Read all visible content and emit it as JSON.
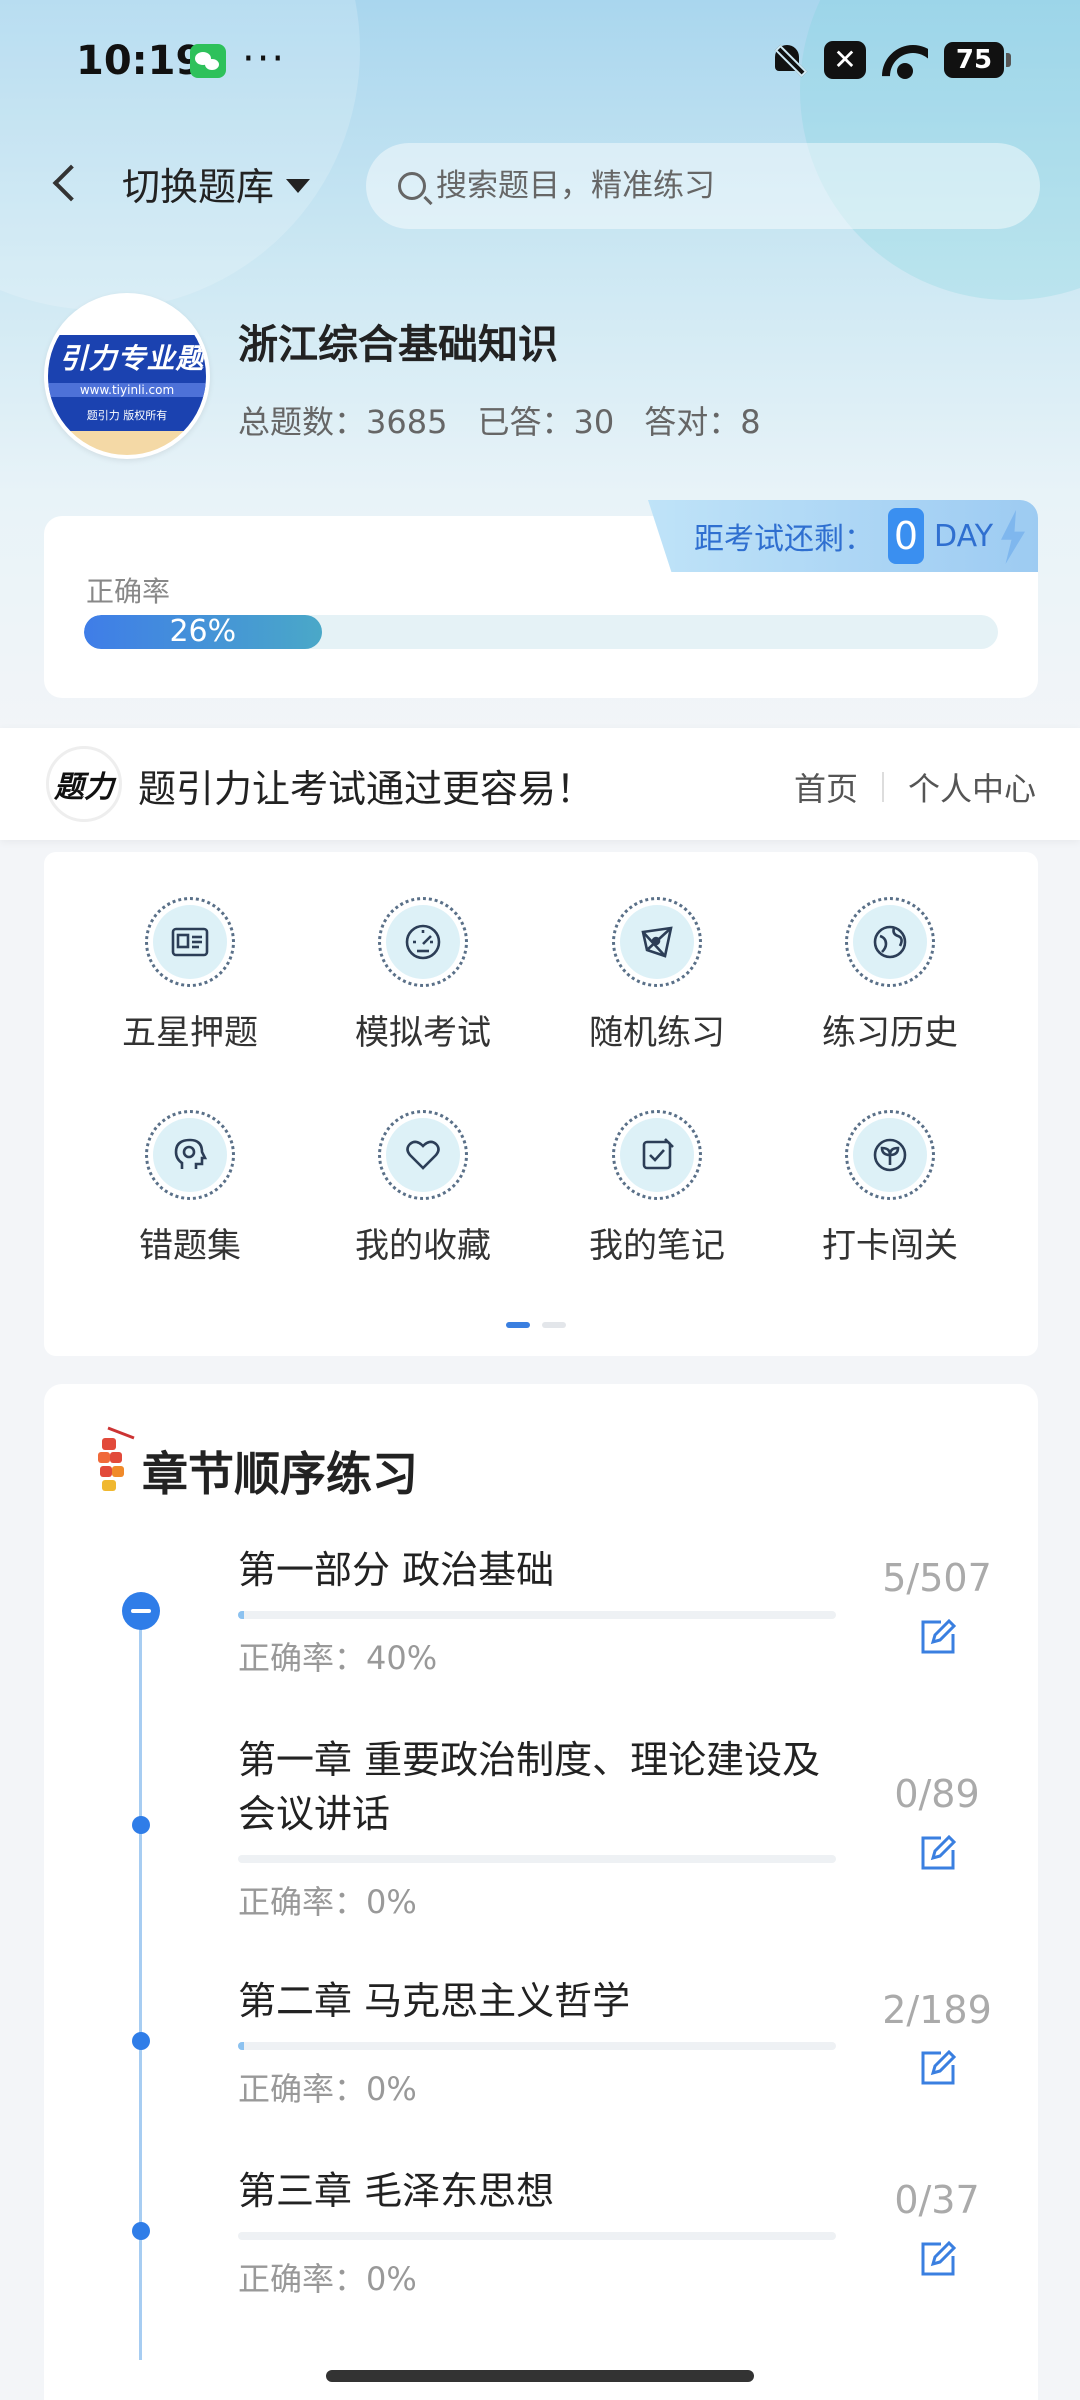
{
  "status_bar": {
    "time": "10:19",
    "dots": "···",
    "x_label": "✕",
    "battery": "75"
  },
  "topbar": {
    "switch_label": "切换题库",
    "search_placeholder": "搜索题目，精准练习"
  },
  "bank": {
    "logo_text": "引力专业题",
    "logo_url": "www.tiyinli.com",
    "logo_copyright": "题引力 版权所有",
    "name": "浙江综合基础知识",
    "total": "总题数：3685",
    "answered": "已答：30",
    "correct": "答对：8"
  },
  "exam": {
    "label": "距考试还剩：",
    "days": "0",
    "unit": "DAY"
  },
  "accuracy": {
    "label": "正确率",
    "value_text": "26%",
    "percent": 26
  },
  "slogan": {
    "logo_text": "题力",
    "text": "题引力让考试通过更容易！",
    "nav": [
      "首页",
      "个人中心"
    ]
  },
  "features": [
    {
      "label": "五星押题",
      "icon": "id-card-icon"
    },
    {
      "label": "模拟考试",
      "icon": "speedometer-icon"
    },
    {
      "label": "随机练习",
      "icon": "network-icon"
    },
    {
      "label": "练习历史",
      "icon": "globe-icon"
    },
    {
      "label": "错题集",
      "icon": "head-icon"
    },
    {
      "label": "我的收藏",
      "icon": "heart-icon"
    },
    {
      "label": "我的笔记",
      "icon": "note-check-icon"
    },
    {
      "label": "打卡闯关",
      "icon": "leaf-icon"
    }
  ],
  "pager": {
    "active": 0,
    "count": 2
  },
  "chapters_title": "章节顺序练习",
  "chapters": [
    {
      "name": "第一部分 政治基础",
      "accuracy": "正确率：40%",
      "count": "5/507",
      "progress": 0.0099
    },
    {
      "name": "第一章 重要政治制度、理论建设及会议讲话",
      "accuracy": "正确率：0%",
      "count": "0/89",
      "progress": 0
    },
    {
      "name": "第二章 马克思主义哲学",
      "accuracy": "正确率：0%",
      "count": "2/189",
      "progress": 0.0106
    },
    {
      "name": "第三章 毛泽东思想",
      "accuracy": "正确率：0%",
      "count": "0/37",
      "progress": 0
    }
  ],
  "colors": {
    "accent": "#2f7de8",
    "accent_light": "#a7cdf2",
    "icon_bg": "#ddf1f7"
  }
}
